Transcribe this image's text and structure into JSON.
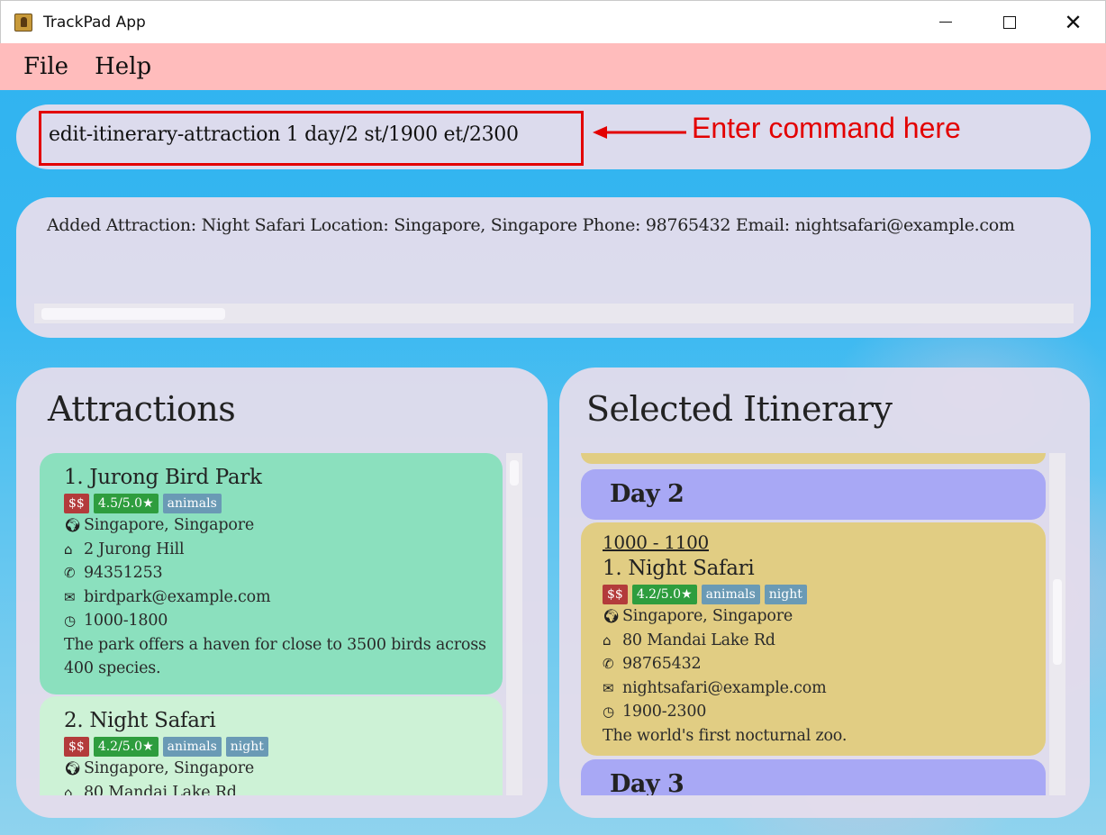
{
  "window": {
    "title": "TrackPad App",
    "close_glyph": "✕"
  },
  "menu": {
    "items": [
      "File",
      "Help"
    ]
  },
  "command": {
    "value": "edit-itinerary-attraction 1 day/2 st/1900 et/2300",
    "annotation": "Enter command here",
    "annotation_color": "#e30000"
  },
  "result": {
    "text": "Added Attraction: Night Safari Location: Singapore, Singapore Phone: 98765432 Email: nightsafari@example.com"
  },
  "attractions": {
    "title": "Attractions",
    "items": [
      {
        "name": "1.  Jurong Bird Park",
        "price": "$$",
        "rating": "4.5/5.0★",
        "tags": [
          "animals"
        ],
        "location": "Singapore, Singapore",
        "address": "2 Jurong Hill",
        "phone": "94351253",
        "email": "birdpark@example.com",
        "hours": "1000-1800",
        "description": "The park offers a haven for close to 3500 birds across 400 species."
      },
      {
        "name": "2.  Night Safari",
        "price": "$$",
        "rating": "4.2/5.0★",
        "tags": [
          "animals",
          "night"
        ],
        "location": "Singapore, Singapore",
        "address": "80 Mandai Lake Rd"
      }
    ]
  },
  "itinerary": {
    "title": "Selected Itinerary",
    "days": [
      "Day 2",
      "Day 3"
    ],
    "entry": {
      "time": "1000 - 1100",
      "name": "1.  Night Safari",
      "price": "$$",
      "rating": "4.2/5.0★",
      "tags": [
        "animals",
        "night"
      ],
      "location": "Singapore, Singapore",
      "address": "80 Mandai Lake Rd",
      "phone": "98765432",
      "email": "nightsafari@example.com",
      "hours": "1900-2300",
      "description": "The world's first nocturnal zoo."
    }
  },
  "icons": {
    "location": "globe-icon",
    "address": "home-icon",
    "phone": "phone-icon",
    "email": "mail-icon",
    "hours": "clock-icon"
  },
  "colors": {
    "menubar": "#ffbcbc",
    "card_selected": "#8be0be",
    "card_default": "#cdf2d6",
    "day_header": "#a8a8f5",
    "itinerary_card": "#e1cd83",
    "tag_price": "#b33b3b",
    "tag_rating": "#2e9d3e",
    "tag_keyword": "#6a9ab5"
  }
}
